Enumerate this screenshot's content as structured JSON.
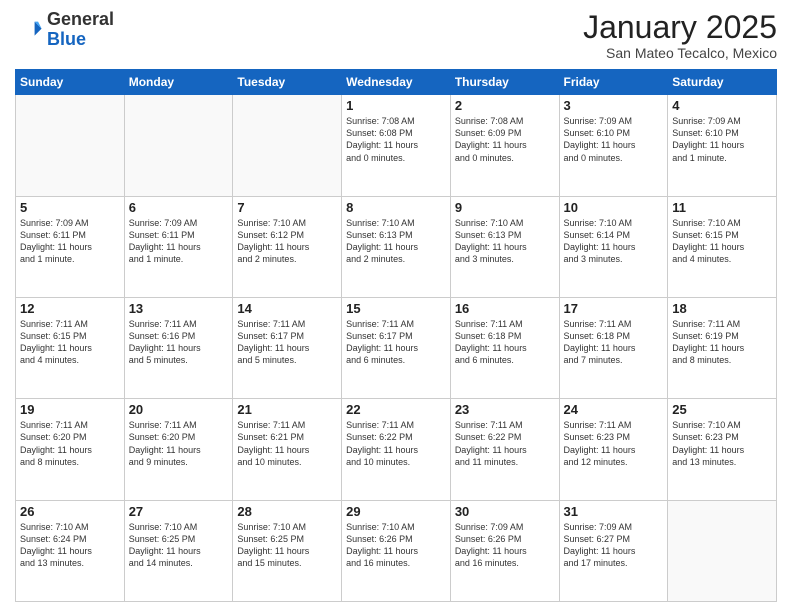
{
  "header": {
    "logo_general": "General",
    "logo_blue": "Blue",
    "month_title": "January 2025",
    "location": "San Mateo Tecalco, Mexico"
  },
  "days_of_week": [
    "Sunday",
    "Monday",
    "Tuesday",
    "Wednesday",
    "Thursday",
    "Friday",
    "Saturday"
  ],
  "weeks": [
    [
      {
        "day": "",
        "info": ""
      },
      {
        "day": "",
        "info": ""
      },
      {
        "day": "",
        "info": ""
      },
      {
        "day": "1",
        "info": "Sunrise: 7:08 AM\nSunset: 6:08 PM\nDaylight: 11 hours\nand 0 minutes."
      },
      {
        "day": "2",
        "info": "Sunrise: 7:08 AM\nSunset: 6:09 PM\nDaylight: 11 hours\nand 0 minutes."
      },
      {
        "day": "3",
        "info": "Sunrise: 7:09 AM\nSunset: 6:10 PM\nDaylight: 11 hours\nand 0 minutes."
      },
      {
        "day": "4",
        "info": "Sunrise: 7:09 AM\nSunset: 6:10 PM\nDaylight: 11 hours\nand 1 minute."
      }
    ],
    [
      {
        "day": "5",
        "info": "Sunrise: 7:09 AM\nSunset: 6:11 PM\nDaylight: 11 hours\nand 1 minute."
      },
      {
        "day": "6",
        "info": "Sunrise: 7:09 AM\nSunset: 6:11 PM\nDaylight: 11 hours\nand 1 minute."
      },
      {
        "day": "7",
        "info": "Sunrise: 7:10 AM\nSunset: 6:12 PM\nDaylight: 11 hours\nand 2 minutes."
      },
      {
        "day": "8",
        "info": "Sunrise: 7:10 AM\nSunset: 6:13 PM\nDaylight: 11 hours\nand 2 minutes."
      },
      {
        "day": "9",
        "info": "Sunrise: 7:10 AM\nSunset: 6:13 PM\nDaylight: 11 hours\nand 3 minutes."
      },
      {
        "day": "10",
        "info": "Sunrise: 7:10 AM\nSunset: 6:14 PM\nDaylight: 11 hours\nand 3 minutes."
      },
      {
        "day": "11",
        "info": "Sunrise: 7:10 AM\nSunset: 6:15 PM\nDaylight: 11 hours\nand 4 minutes."
      }
    ],
    [
      {
        "day": "12",
        "info": "Sunrise: 7:11 AM\nSunset: 6:15 PM\nDaylight: 11 hours\nand 4 minutes."
      },
      {
        "day": "13",
        "info": "Sunrise: 7:11 AM\nSunset: 6:16 PM\nDaylight: 11 hours\nand 5 minutes."
      },
      {
        "day": "14",
        "info": "Sunrise: 7:11 AM\nSunset: 6:17 PM\nDaylight: 11 hours\nand 5 minutes."
      },
      {
        "day": "15",
        "info": "Sunrise: 7:11 AM\nSunset: 6:17 PM\nDaylight: 11 hours\nand 6 minutes."
      },
      {
        "day": "16",
        "info": "Sunrise: 7:11 AM\nSunset: 6:18 PM\nDaylight: 11 hours\nand 6 minutes."
      },
      {
        "day": "17",
        "info": "Sunrise: 7:11 AM\nSunset: 6:18 PM\nDaylight: 11 hours\nand 7 minutes."
      },
      {
        "day": "18",
        "info": "Sunrise: 7:11 AM\nSunset: 6:19 PM\nDaylight: 11 hours\nand 8 minutes."
      }
    ],
    [
      {
        "day": "19",
        "info": "Sunrise: 7:11 AM\nSunset: 6:20 PM\nDaylight: 11 hours\nand 8 minutes."
      },
      {
        "day": "20",
        "info": "Sunrise: 7:11 AM\nSunset: 6:20 PM\nDaylight: 11 hours\nand 9 minutes."
      },
      {
        "day": "21",
        "info": "Sunrise: 7:11 AM\nSunset: 6:21 PM\nDaylight: 11 hours\nand 10 minutes."
      },
      {
        "day": "22",
        "info": "Sunrise: 7:11 AM\nSunset: 6:22 PM\nDaylight: 11 hours\nand 10 minutes."
      },
      {
        "day": "23",
        "info": "Sunrise: 7:11 AM\nSunset: 6:22 PM\nDaylight: 11 hours\nand 11 minutes."
      },
      {
        "day": "24",
        "info": "Sunrise: 7:11 AM\nSunset: 6:23 PM\nDaylight: 11 hours\nand 12 minutes."
      },
      {
        "day": "25",
        "info": "Sunrise: 7:10 AM\nSunset: 6:23 PM\nDaylight: 11 hours\nand 13 minutes."
      }
    ],
    [
      {
        "day": "26",
        "info": "Sunrise: 7:10 AM\nSunset: 6:24 PM\nDaylight: 11 hours\nand 13 minutes."
      },
      {
        "day": "27",
        "info": "Sunrise: 7:10 AM\nSunset: 6:25 PM\nDaylight: 11 hours\nand 14 minutes."
      },
      {
        "day": "28",
        "info": "Sunrise: 7:10 AM\nSunset: 6:25 PM\nDaylight: 11 hours\nand 15 minutes."
      },
      {
        "day": "29",
        "info": "Sunrise: 7:10 AM\nSunset: 6:26 PM\nDaylight: 11 hours\nand 16 minutes."
      },
      {
        "day": "30",
        "info": "Sunrise: 7:09 AM\nSunset: 6:26 PM\nDaylight: 11 hours\nand 16 minutes."
      },
      {
        "day": "31",
        "info": "Sunrise: 7:09 AM\nSunset: 6:27 PM\nDaylight: 11 hours\nand 17 minutes."
      },
      {
        "day": "",
        "info": ""
      }
    ]
  ]
}
